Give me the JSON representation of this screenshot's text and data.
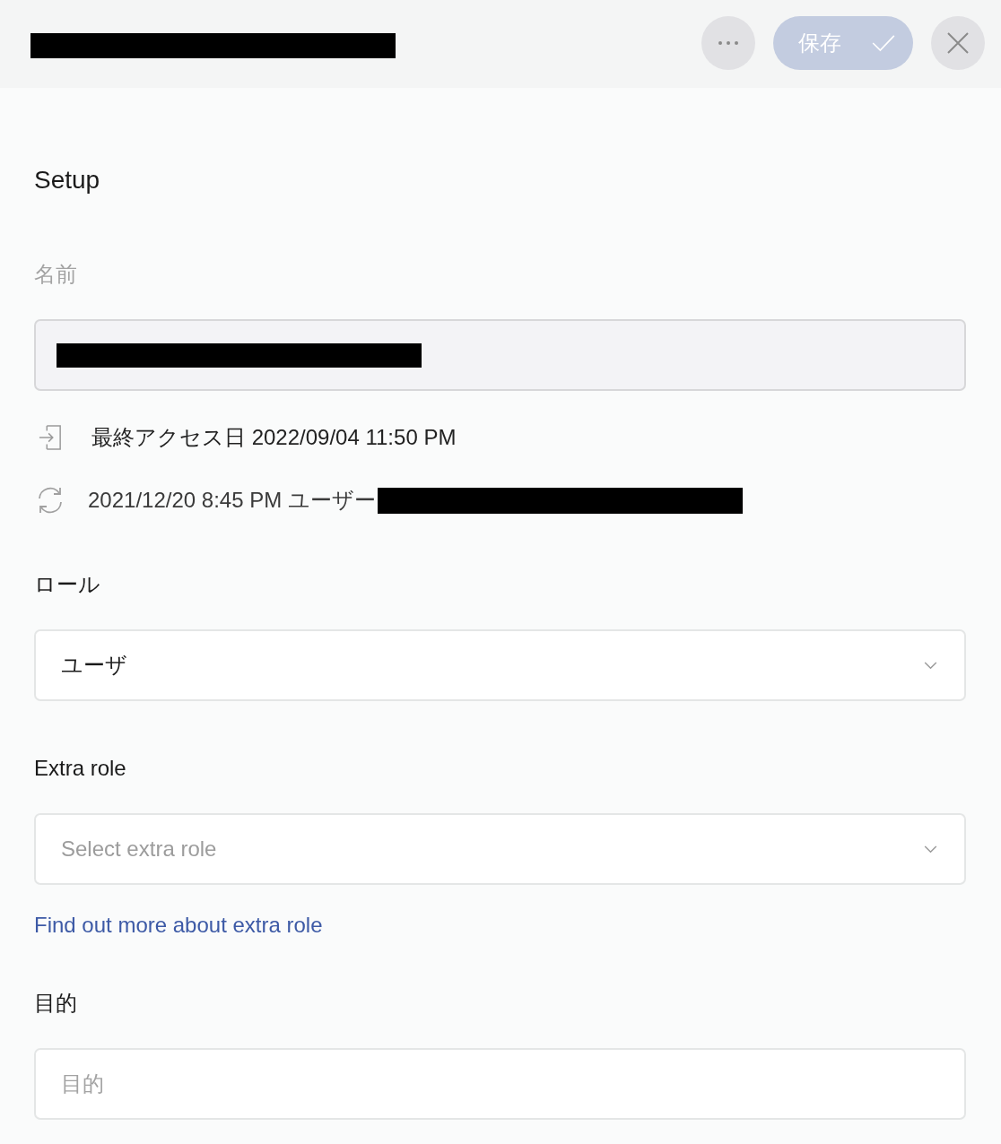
{
  "header": {
    "title_redacted": true,
    "actions": [
      {
        "kind": "more"
      },
      {
        "kind": "save",
        "label": "保存",
        "disabled": true
      },
      {
        "kind": "close"
      }
    ]
  },
  "section_title": "Setup",
  "name_field": {
    "label": "名前",
    "disabled": true,
    "value_redacted": true
  },
  "activity": [
    {
      "kind": "last_access",
      "text": "最終アクセス日 2022/09/04 11:50 PM",
      "user_redacted": false
    },
    {
      "kind": "updated",
      "text": "2021/12/20 8:45 PM ユーザー",
      "user_redacted": true
    }
  ],
  "role": {
    "label": "ロール",
    "value": "ユーザ"
  },
  "extra_role": {
    "label": "Extra role",
    "placeholder": "Select extra role",
    "link": "Find out more about extra role"
  },
  "purpose": {
    "label": "目的",
    "placeholder": "目的"
  }
}
